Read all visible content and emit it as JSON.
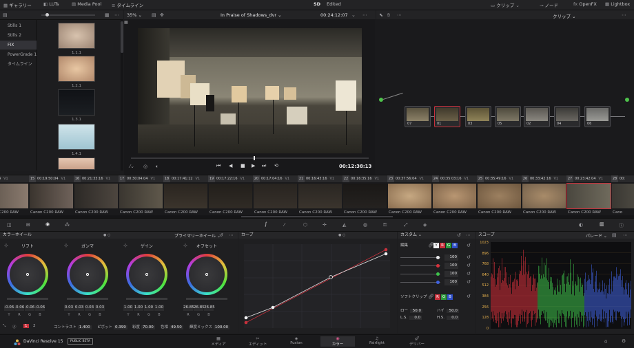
{
  "topbar": {
    "gallery": "ギャラリー",
    "luts": "LUTs",
    "mediapool": "Media Pool",
    "timeline": "タイムライン",
    "project_mode": "SD",
    "project_status": "Edited",
    "clip_menu": "クリップ",
    "node_menu": "ノード",
    "openfx": "OpenFX",
    "lightbox": "Lightbox"
  },
  "viewer": {
    "zoom": "35%",
    "clip_name": "In Praise of Shadows_dvr",
    "timecode_top": "00:24:12:07",
    "timecode_bottom": "00:12:38:13"
  },
  "nodes_header": {
    "clip_select": "クリップ"
  },
  "sidebar": {
    "items": [
      {
        "label": "Stills 1"
      },
      {
        "label": "Stills 2"
      },
      {
        "label": "FIX"
      },
      {
        "label": "PowerGrade 1"
      },
      {
        "label": "タイムライン"
      }
    ]
  },
  "stills": [
    {
      "label": "1.1.1"
    },
    {
      "label": "1.2.1"
    },
    {
      "label": "1.3.1"
    },
    {
      "label": "1.4.1"
    }
  ],
  "nodes": [
    {
      "label": "07"
    },
    {
      "label": "01"
    },
    {
      "label": "03"
    },
    {
      "label": "05"
    },
    {
      "label": "02"
    },
    {
      "label": "04"
    },
    {
      "label": "06"
    }
  ],
  "clips": [
    {
      "num": "",
      "tc": ":21:09:04",
      "track": "V1",
      "label": "Canon C200 RAW"
    },
    {
      "num": "15",
      "tc": "00:19:50:04",
      "track": "V1",
      "label": "Canon C200 RAW"
    },
    {
      "num": "16",
      "tc": "00:21:33:16",
      "track": "V1",
      "label": "Canon C200 RAW"
    },
    {
      "num": "17",
      "tc": "00:30:04:04",
      "track": "V1",
      "label": "Canon C200 RAW"
    },
    {
      "num": "18",
      "tc": "00:17:41:12",
      "track": "V1",
      "label": "Canon C200 RAW"
    },
    {
      "num": "19",
      "tc": "00:17:22:16",
      "track": "V1",
      "label": "Canon C200 RAW"
    },
    {
      "num": "20",
      "tc": "00:17:04:16",
      "track": "V1",
      "label": "Canon C200 RAW"
    },
    {
      "num": "21",
      "tc": "00:16:43:16",
      "track": "V1",
      "label": "Canon C200 RAW"
    },
    {
      "num": "22",
      "tc": "00:16:35:16",
      "track": "V1",
      "label": "Canon C200 RAW"
    },
    {
      "num": "23",
      "tc": "00:37:56:04",
      "track": "V1",
      "label": "Canon C200 RAW"
    },
    {
      "num": "24",
      "tc": "00:35:03:16",
      "track": "V1",
      "label": "Canon C200 RAW"
    },
    {
      "num": "25",
      "tc": "00:35:49:16",
      "track": "V1",
      "label": "Canon C200 RAW"
    },
    {
      "num": "26",
      "tc": "00:33:42:16",
      "track": "V1",
      "label": "Canon C200 RAW"
    },
    {
      "num": "27",
      "tc": "00:23:42:04",
      "track": "V1",
      "label": "Canon C200 RAW"
    },
    {
      "num": "28",
      "tc": "00:",
      "track": "",
      "label": "Cano"
    }
  ],
  "wheels_panel": {
    "title": "カラーホイール",
    "mode": "プライマリーホイール",
    "wheels": [
      {
        "label": "リフト",
        "values": [
          "-0.06",
          "-0.06",
          "-0.06",
          "-0.06"
        ]
      },
      {
        "label": "ガンマ",
        "values": [
          "0.03",
          "0.03",
          "0.03",
          "0.03"
        ]
      },
      {
        "label": "ゲイン",
        "values": [
          "1.00",
          "1.00",
          "1.00",
          "1.00"
        ]
      },
      {
        "label": "オフセット",
        "values": [
          "26.85",
          "26.85",
          "26.85"
        ]
      }
    ],
    "channels4": [
      "Y",
      "R",
      "G",
      "B"
    ],
    "channels3": [
      "R",
      "G",
      "B"
    ],
    "page_a": "1",
    "page_b": "2",
    "contrast_label": "コントラスト",
    "contrast": "1.400",
    "pivot_label": "ピボット",
    "pivot": "0.399",
    "sat_label": "彩度",
    "sat": "70.00",
    "hue_label": "色相",
    "hue": "49.50",
    "lummix_label": "輝度ミックス",
    "lummix": "100.00"
  },
  "curves_panel": {
    "title": "カーブ",
    "custom_label": "カスタム"
  },
  "custom_panel": {
    "edit_label": "編集",
    "y": "Y",
    "r": "R",
    "g": "G",
    "b": "B",
    "values": [
      "100",
      "100",
      "100",
      "100"
    ],
    "softclip_label": "ソフトクリップ",
    "low_label": "ロー",
    "low": "50.0",
    "high_label": "ハイ",
    "high": "50.0",
    "ls_label": "L.S.",
    "ls": "0.0",
    "hs_label": "H.S.",
    "hs": "0.0"
  },
  "scope_panel": {
    "title": "スコープ",
    "mode": "パレード",
    "y_ticks": [
      "1023",
      "896",
      "768",
      "640",
      "512",
      "384",
      "256",
      "128",
      "0"
    ]
  },
  "footer": {
    "app": "DaVinci Resolve 15",
    "badge": "PUBLIC BETA",
    "pages": [
      {
        "label": "メディア"
      },
      {
        "label": "エディット"
      },
      {
        "label": "Fusion"
      },
      {
        "label": "カラー"
      },
      {
        "label": "Fairlight"
      },
      {
        "label": "デリバー"
      }
    ]
  },
  "colors": {
    "accent_red": "#c8313c",
    "scope_red": "#d8323c",
    "scope_green": "#3ec24b",
    "scope_blue": "#4062e0",
    "tick_yellow": "#e7b14d"
  }
}
